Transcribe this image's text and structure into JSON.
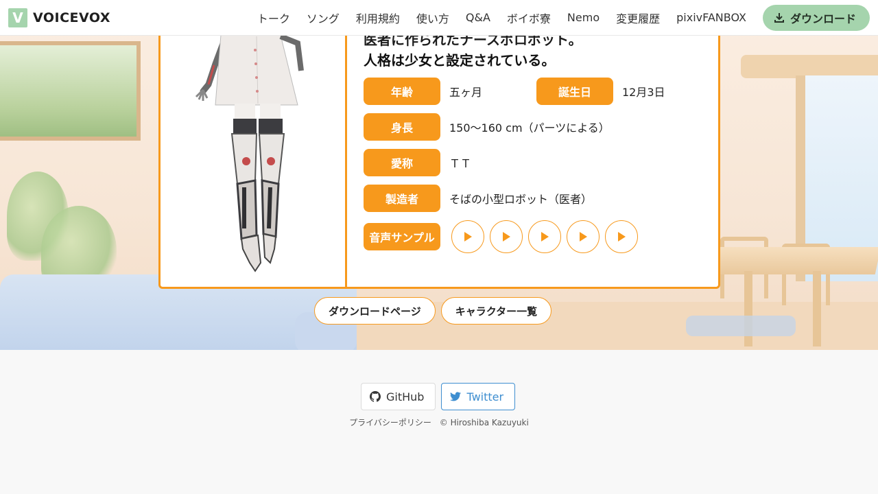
{
  "header": {
    "logo_letter": "V",
    "logo_text": "VOICEVOX",
    "nav": [
      "トーク",
      "ソング",
      "利用規約",
      "使い方",
      "Q&A",
      "ボイボ寮",
      "Nemo",
      "変更履歴",
      "pixivFANBOX"
    ],
    "download_label": "ダウンロード"
  },
  "character": {
    "description_line1": "医者に作られたナースボロボット。",
    "description_line2": "人格は少女と設定されている。",
    "age_label": "年齢",
    "age_value": "五ヶ月",
    "birthday_label": "誕生日",
    "birthday_value": "12月3日",
    "height_label": "身長",
    "height_value": "150〜160 cm（パーツによる）",
    "nickname_label": "愛称",
    "nickname_value": "ＴＴ",
    "maker_label": "製造者",
    "maker_value": "そばの小型ロボット（医者）",
    "samples_label": "音声サンプル",
    "sample_count": 5
  },
  "links": {
    "download_page": "ダウンロードページ",
    "character_list": "キャラクター一覧"
  },
  "footer": {
    "github": "GitHub",
    "twitter": "Twitter",
    "privacy": "プライバシーポリシー",
    "copyright": "© Hiroshiba Kazuyuki"
  },
  "colors": {
    "accent": "#f7991c",
    "brand": "#a5d4ad",
    "twitter": "#3e8ed0"
  }
}
